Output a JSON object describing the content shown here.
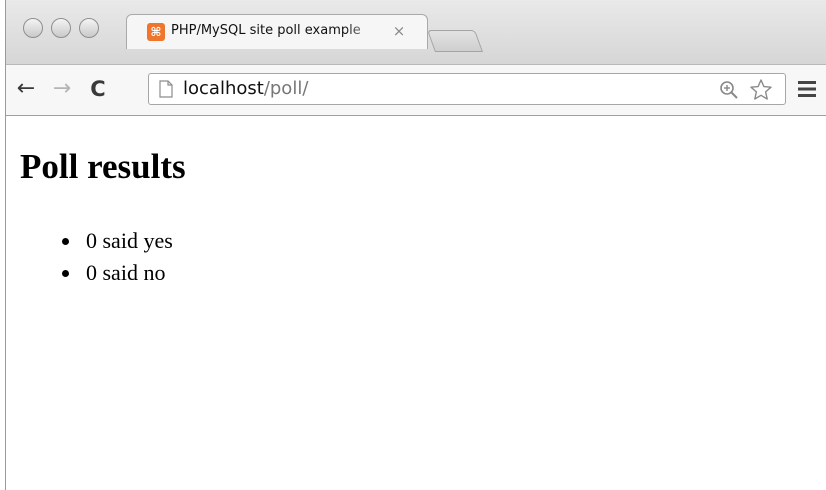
{
  "browser": {
    "tab": {
      "title": "PHP/MySQL site poll example",
      "close": "×"
    },
    "toolbar": {
      "back": "←",
      "forward": "→",
      "reload": "C"
    },
    "address": {
      "host": "localhost",
      "path": "/poll/"
    },
    "colors": {
      "favicon": "#f0762c",
      "url_path": "#777777"
    },
    "icons": [
      "page-icon",
      "zoom-icon",
      "star-icon",
      "menu-icon",
      "back-arrow-icon",
      "forward-arrow-icon",
      "reload-icon",
      "close-icon"
    ]
  },
  "page": {
    "heading": "Poll results",
    "results": [
      {
        "text": "0 said yes"
      },
      {
        "text": "0 said no"
      }
    ]
  }
}
